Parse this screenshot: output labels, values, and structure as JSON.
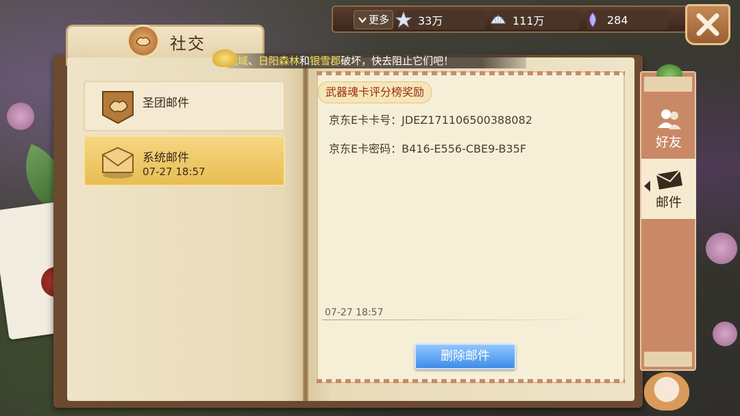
{
  "topbar": {
    "more_label": "更多",
    "stars": "33万",
    "shells": "111万",
    "gems": "284"
  },
  "book": {
    "title": "社交"
  },
  "marquee": {
    "part1": "祇域",
    "sep1": "、",
    "place1": "日阳森林",
    "and": "和",
    "place2": "银雪郡",
    "rest": "破坏，快去阻止它们吧！"
  },
  "mail_list": [
    {
      "name": "圣团邮件",
      "date": ""
    },
    {
      "name": "系统邮件",
      "date": "07-27 18:57"
    }
  ],
  "mail_detail": {
    "subject": "武器魂卡评分榜奖励",
    "card_no_label": "京东E卡卡号：",
    "card_no": "JDEZ171106500388082",
    "card_pwd_label": "京东E卡密码：",
    "card_pwd": "B416-E556-CBE9-B35F",
    "date": "07-27 18:57",
    "delete_label": "删除邮件"
  },
  "side_tabs": [
    {
      "label": "好友"
    },
    {
      "label": "邮件"
    }
  ],
  "colors": {
    "accent_blue": "#3f8de8",
    "selected_gold": "#e9bd52",
    "subject_red": "#9c2a16"
  }
}
